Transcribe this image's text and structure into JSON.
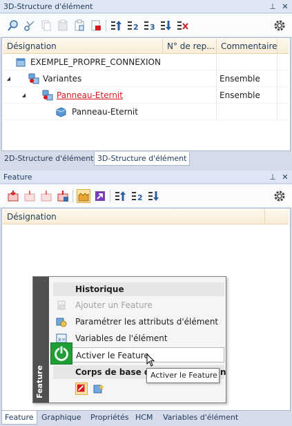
{
  "panel3d": {
    "title": "3D-Structure d'élément",
    "pin_icon": "pin-icon",
    "close_icon": "close-icon",
    "columns": [
      "Désignation",
      "N° de rep...",
      "Commentaire"
    ],
    "rows": [
      {
        "name": "EXEMPLE_PROPRE_CONNEXION",
        "comment": ""
      },
      {
        "name": "Variantes",
        "comment": "Ensemble"
      },
      {
        "name": "Panneau-Eternit",
        "comment": "Ensemble"
      },
      {
        "name": "Panneau-Eternit",
        "comment": ""
      }
    ],
    "tabs": [
      "2D-Structure d'élément",
      "3D-Structure d'élément"
    ]
  },
  "feature": {
    "title": "Feature",
    "column": "Désignation",
    "tabs": [
      "Feature",
      "Graphique",
      "Propriétés",
      "HCM",
      "Variables d'élément"
    ]
  },
  "popup": {
    "side_label": "Feature",
    "section1": "Historique",
    "items": [
      "Ajouter un Feature",
      "Paramétrer les attributs d'élément",
      "Variables de l'élément",
      "Activer le Feature"
    ],
    "section2": "Corps de base des",
    "section2_tail": "n",
    "tooltip": "Activer le Feature"
  },
  "colors": {
    "accent_red": "#d71920",
    "header_bg": "#dde6f2",
    "power_green": "#1f9e35"
  }
}
